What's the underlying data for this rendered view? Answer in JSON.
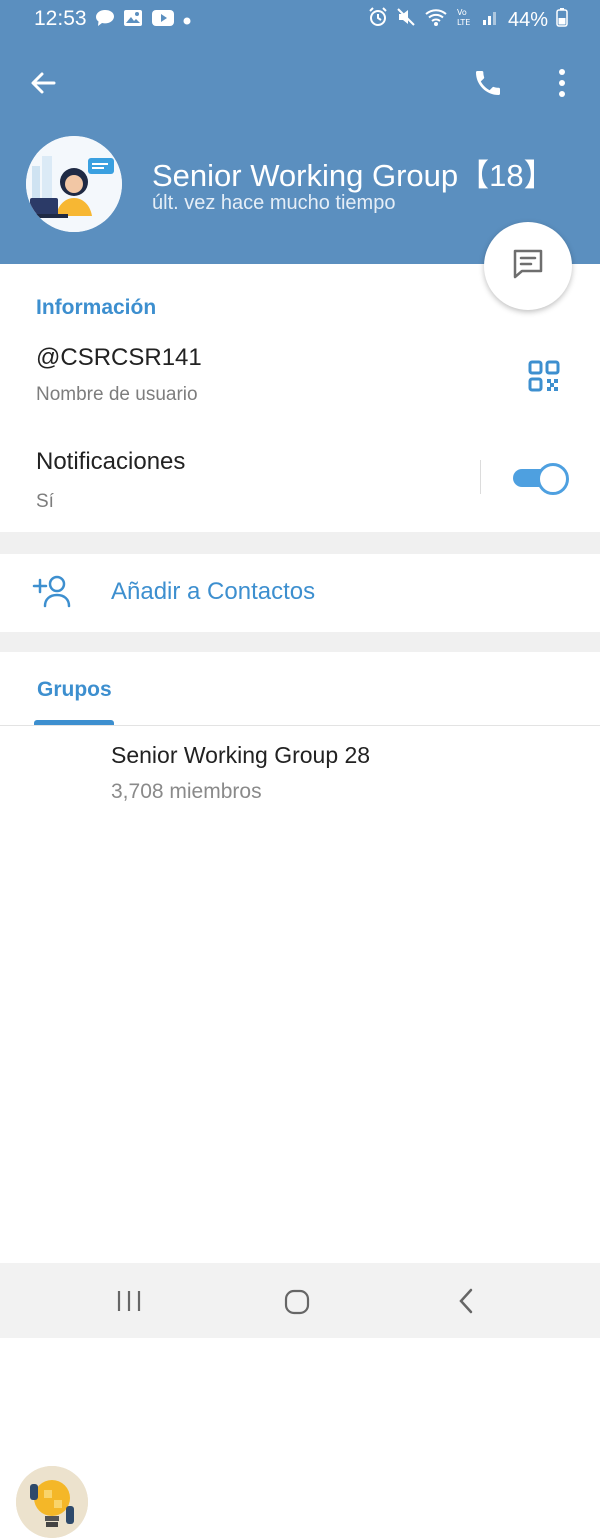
{
  "status_bar": {
    "time": "12:53",
    "battery": "44%",
    "left_icons": [
      "chat-bubble-icon",
      "image-icon",
      "youtube-icon",
      "dot-icon"
    ],
    "right_icons": [
      "alarm-icon",
      "mute-icon",
      "wifi-icon",
      "volte-icon",
      "signal-icon",
      "battery-icon"
    ]
  },
  "header": {
    "title": "Senior Working Group【18】",
    "subtitle": "últ. vez hace mucho tiempo",
    "color": "#5b8fbf"
  },
  "info": {
    "section_title": "Información",
    "username": "@CSRCSR141",
    "username_label": "Nombre de usuario",
    "notifications_label": "Notificaciones",
    "notifications_value": "Sí",
    "notifications_on": true
  },
  "actions": {
    "add_contact": "Añadir a Contactos"
  },
  "groups": {
    "tab_label": "Grupos",
    "items": [
      {
        "name": "Senior Working Group 28",
        "members": "3,708 miembros"
      }
    ]
  },
  "colors": {
    "accent": "#3d8fcf",
    "header": "#5b8fbf",
    "toggle": "#4ea0e0"
  }
}
